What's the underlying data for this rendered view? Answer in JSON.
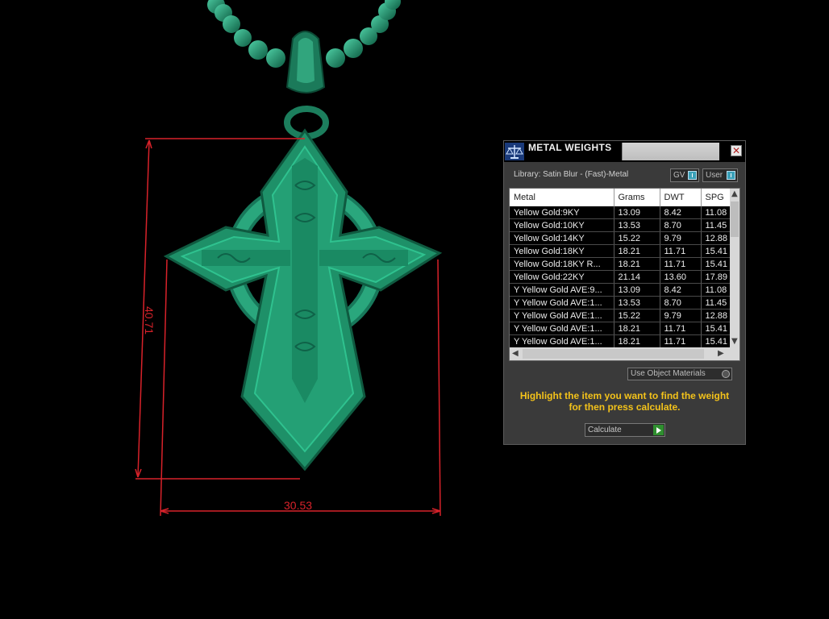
{
  "viewport": {
    "dimension_height": "40.71",
    "dimension_width": "30.53",
    "model_color": "#1f8c66",
    "dimension_color": "#d8222a"
  },
  "panel": {
    "title": "METAL WEIGHTS",
    "close_icon": "close-icon",
    "library_label": "Library: Satin Blur - (Fast)-Metal",
    "gv_label": "GV",
    "user_label": "User",
    "table": {
      "columns": [
        "Metal",
        "Grams",
        "DWT",
        "SPG"
      ],
      "rows": [
        [
          "Yellow Gold:9KY",
          "13.09",
          "8.42",
          "11.08"
        ],
        [
          "Yellow Gold:10KY",
          "13.53",
          "8.70",
          "11.45"
        ],
        [
          "Yellow Gold:14KY",
          "15.22",
          "9.79",
          "12.88"
        ],
        [
          "Yellow Gold:18KY",
          "18.21",
          "11.71",
          "15.41"
        ],
        [
          "Yellow Gold:18KY R...",
          "18.21",
          "11.71",
          "15.41"
        ],
        [
          "Yellow Gold:22KY",
          "21.14",
          "13.60",
          "17.89"
        ],
        [
          "Y Yellow Gold AVE:9...",
          "13.09",
          "8.42",
          "11.08"
        ],
        [
          "Y Yellow Gold AVE:1...",
          "13.53",
          "8.70",
          "11.45"
        ],
        [
          "Y Yellow Gold AVE:1...",
          "15.22",
          "9.79",
          "12.88"
        ],
        [
          "Y Yellow Gold AVE:1...",
          "18.21",
          "11.71",
          "15.41"
        ],
        [
          "Y Yellow Gold AVE:1...",
          "18.21",
          "11.71",
          "15.41"
        ]
      ]
    },
    "use_object_materials": "Use Object Materials",
    "hint_line1": "Highlight the item you want to find the weight",
    "hint_line2": "for then press calculate.",
    "calculate_label": "Calculate",
    "accent_color": "#f3c21a"
  }
}
